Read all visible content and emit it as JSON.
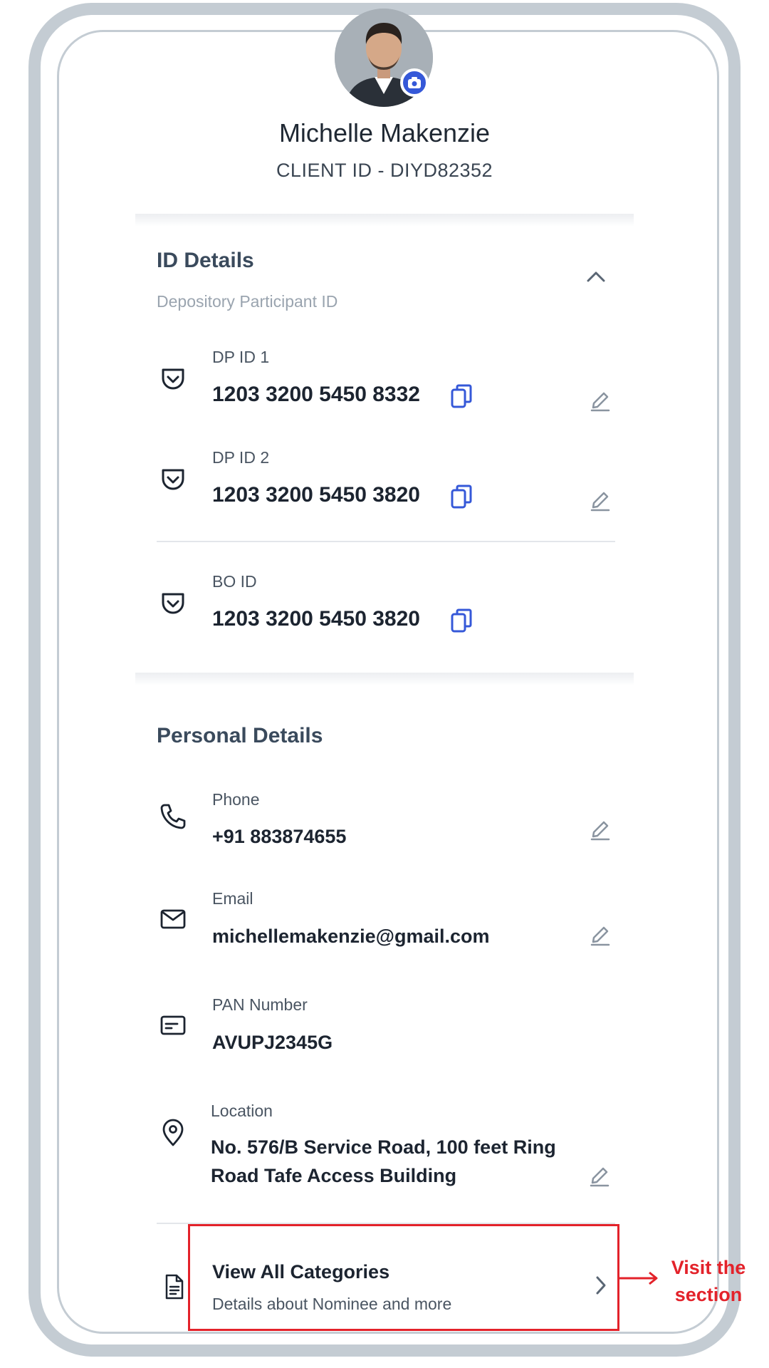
{
  "profile": {
    "name": "Michelle Makenzie",
    "client_id": "CLIENT ID -  DIYD82352"
  },
  "id_details": {
    "title": "ID Details",
    "subtitle": "Depository Participant ID",
    "rows": [
      {
        "label": "DP ID 1",
        "value": "1203 3200 5450 8332"
      },
      {
        "label": "DP ID 2",
        "value": "1203 3200 5450 3820"
      },
      {
        "label": "BO ID",
        "value": "1203 3200 5450 3820"
      }
    ]
  },
  "personal_details": {
    "title": "Personal Details",
    "phone": {
      "label": "Phone",
      "value": "+91  883874655"
    },
    "email": {
      "label": "Email",
      "value": "michellemakenzie@gmail.com"
    },
    "pan": {
      "label": "PAN Number",
      "value": "AVUPJ2345G"
    },
    "location": {
      "label": "Location",
      "line1": "No. 576/B Service Road, 100 feet Ring",
      "line2": "Road Tafe Access Building"
    }
  },
  "categories": {
    "title": "View All Categories",
    "subtitle": "Details about Nominee and more"
  },
  "annotation": {
    "line1": "Visit the",
    "line2": "section"
  },
  "colors": {
    "accent": "#3558d8",
    "highlight": "#e3222a",
    "frame": "#c4ccd3"
  }
}
